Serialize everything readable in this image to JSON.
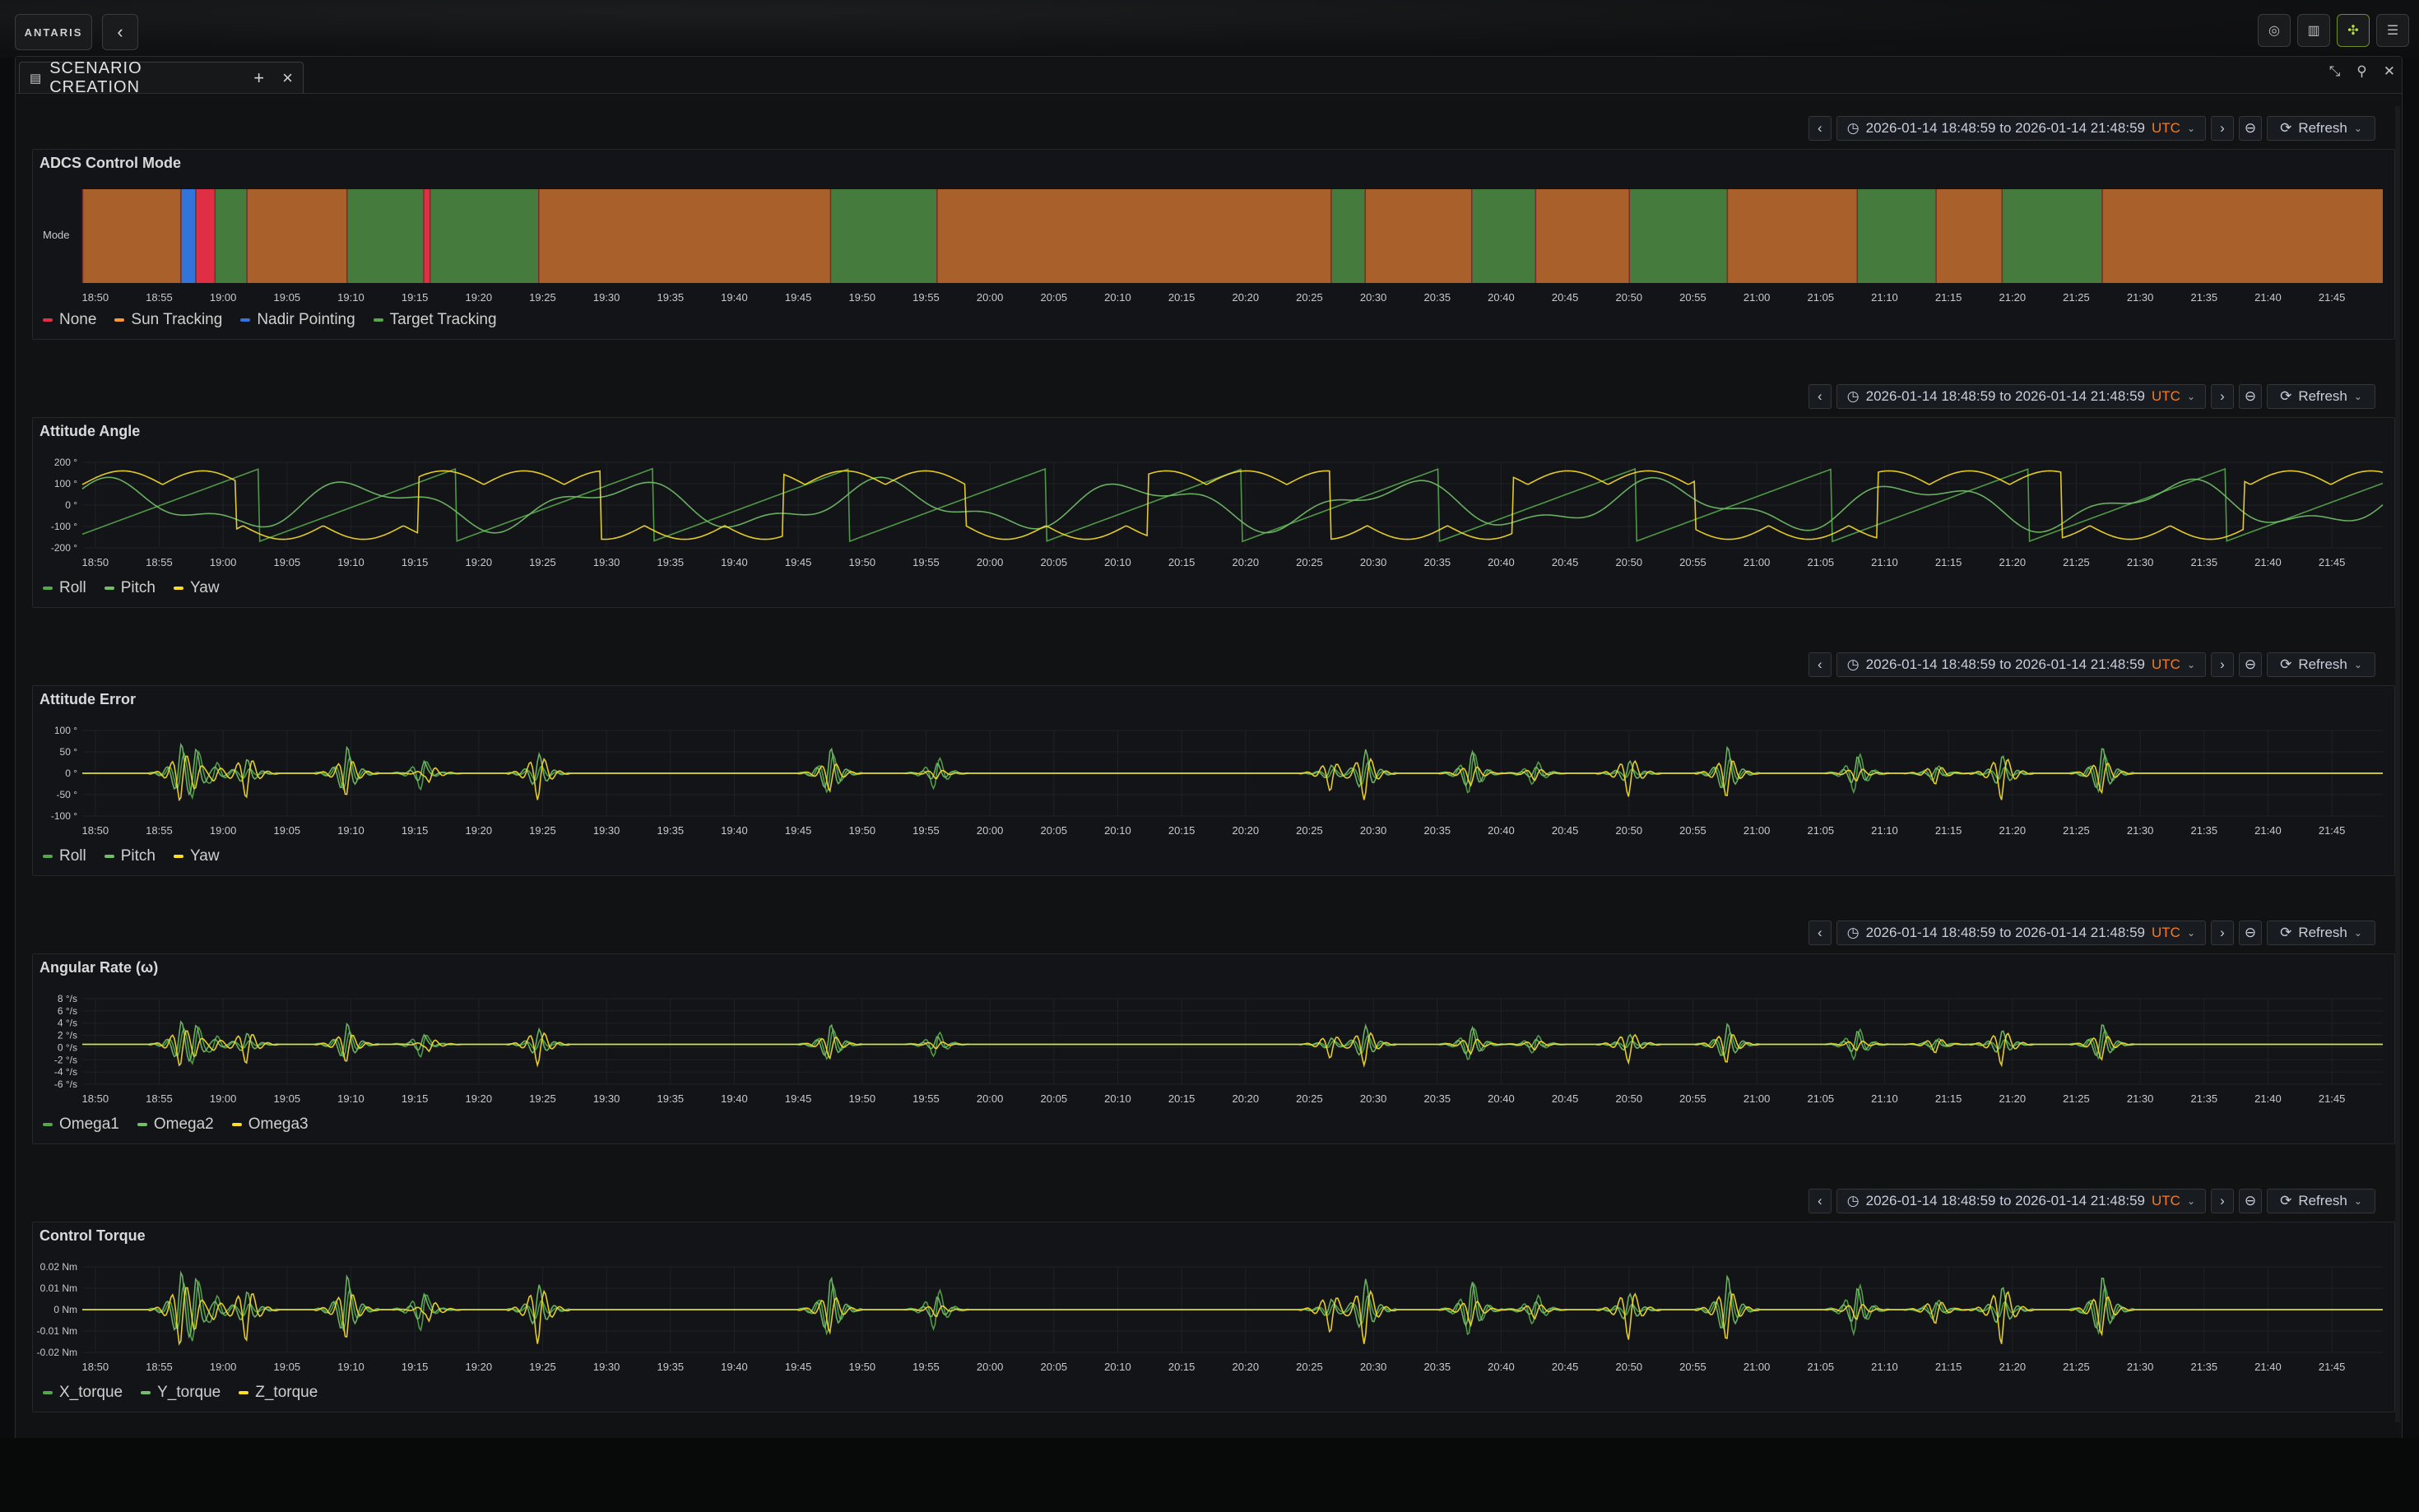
{
  "app": {
    "logo_text": "ANTARIS",
    "back_icon": "chevron-left-icon",
    "top_icons": [
      "satellite-orbit-icon",
      "chart-icon",
      "spacecraft-icon",
      "database-icon"
    ],
    "tab": {
      "title": "SCENARIO CREATION",
      "doc_icon": "document-icon",
      "add_icon": "plus-icon",
      "close_icon": "close-icon"
    },
    "window_controls": [
      "collapse-icon",
      "pin-icon",
      "close-icon"
    ]
  },
  "time_range": {
    "text": "2026-01-14 18:48:59 to 2026-01-14 21:48:59",
    "tz": "UTC",
    "refresh_label": "Refresh",
    "accent": "#f77c1e"
  },
  "colors": {
    "none": "#e02f44",
    "sun_tracking": "#ff9830",
    "nadir_pointing": "#3274d9",
    "target_tracking": "#56a64b",
    "series_a": "#56a64b",
    "series_b": "#73bf69",
    "series_c": "#fade2a"
  },
  "time_axis": [
    "18:50",
    "18:55",
    "19:00",
    "19:05",
    "19:10",
    "19:15",
    "19:20",
    "19:25",
    "19:30",
    "19:35",
    "19:40",
    "19:45",
    "19:50",
    "19:55",
    "20:00",
    "20:05",
    "20:10",
    "20:15",
    "20:20",
    "20:25",
    "20:30",
    "20:35",
    "20:40",
    "20:45",
    "20:50",
    "20:55",
    "21:00",
    "21:05",
    "21:10",
    "21:15",
    "21:20",
    "21:25",
    "21:30",
    "21:35",
    "21:40",
    "21:45"
  ],
  "chart_data": [
    {
      "type": "state-timeline",
      "title": "ADCS Control Mode",
      "row_label": "Mode",
      "legend": [
        "None",
        "Sun Tracking",
        "Nadir Pointing",
        "Target Tracking"
      ],
      "x_range": [
        "18:48:59",
        "21:48:59"
      ],
      "segments": [
        {
          "start": "18:48:59",
          "end": "18:56:40",
          "state": "Sun Tracking"
        },
        {
          "start": "18:56:40",
          "end": "18:57:50",
          "state": "Nadir Pointing"
        },
        {
          "start": "18:57:50",
          "end": "18:59:20",
          "state": "None"
        },
        {
          "start": "18:59:20",
          "end": "19:01:50",
          "state": "Target Tracking"
        },
        {
          "start": "19:01:50",
          "end": "19:09:40",
          "state": "Sun Tracking"
        },
        {
          "start": "19:09:40",
          "end": "19:15:40",
          "state": "Target Tracking"
        },
        {
          "start": "19:15:40",
          "end": "19:16:10",
          "state": "None"
        },
        {
          "start": "19:16:10",
          "end": "19:24:40",
          "state": "Target Tracking"
        },
        {
          "start": "19:24:40",
          "end": "19:47:30",
          "state": "Sun Tracking"
        },
        {
          "start": "19:47:30",
          "end": "19:55:50",
          "state": "Target Tracking"
        },
        {
          "start": "19:55:50",
          "end": "20:26:40",
          "state": "Sun Tracking"
        },
        {
          "start": "20:26:40",
          "end": "20:29:20",
          "state": "Target Tracking"
        },
        {
          "start": "20:29:20",
          "end": "20:37:40",
          "state": "Sun Tracking"
        },
        {
          "start": "20:37:40",
          "end": "20:42:40",
          "state": "Target Tracking"
        },
        {
          "start": "20:42:40",
          "end": "20:50:00",
          "state": "Sun Tracking"
        },
        {
          "start": "20:50:00",
          "end": "20:57:40",
          "state": "Target Tracking"
        },
        {
          "start": "20:57:40",
          "end": "21:07:50",
          "state": "Sun Tracking"
        },
        {
          "start": "21:07:50",
          "end": "21:14:00",
          "state": "Target Tracking"
        },
        {
          "start": "21:14:00",
          "end": "21:19:10",
          "state": "Sun Tracking"
        },
        {
          "start": "21:19:10",
          "end": "21:27:00",
          "state": "Target Tracking"
        },
        {
          "start": "21:27:00",
          "end": "21:48:59",
          "state": "Sun Tracking"
        }
      ]
    },
    {
      "type": "line",
      "title": "Attitude Angle",
      "y_ticks": [
        "200 °",
        "100 °",
        "0 °",
        "-100 °",
        "-200 °"
      ],
      "ylim": [
        -200,
        200
      ],
      "series": [
        {
          "name": "Roll",
          "pattern": "sawtooth"
        },
        {
          "name": "Pitch",
          "pattern": "wave"
        },
        {
          "name": "Yaw",
          "pattern": "square"
        }
      ]
    },
    {
      "type": "line",
      "title": "Attitude Error",
      "y_ticks": [
        "100 °",
        "50 °",
        "0 °",
        "-50 °",
        "-100 °"
      ],
      "ylim": [
        -100,
        100
      ],
      "series": [
        {
          "name": "Roll"
        },
        {
          "name": "Pitch"
        },
        {
          "name": "Yaw"
        }
      ],
      "spike_times": [
        "18:56:00",
        "18:58:00",
        "19:02:30",
        "19:09:40",
        "19:11:00",
        "19:16:10",
        "19:24:40",
        "19:47:30",
        "19:55:50",
        "20:26:40",
        "20:29:20",
        "20:33:00",
        "20:37:40",
        "20:42:40",
        "20:50:00",
        "20:57:40",
        "21:07:50",
        "21:14:00",
        "21:19:10",
        "21:27:00"
      ]
    },
    {
      "type": "line",
      "title": "Angular Rate (ω)",
      "y_ticks": [
        "8 °/s",
        "6 °/s",
        "4 °/s",
        "2 °/s",
        "0 °/s",
        "-2 °/s",
        "-4 °/s",
        "-6 °/s"
      ],
      "ylim": [
        -7,
        8
      ],
      "series": [
        {
          "name": "Omega1"
        },
        {
          "name": "Omega2"
        },
        {
          "name": "Omega3"
        }
      ]
    },
    {
      "type": "line",
      "title": "Control Torque",
      "y_ticks": [
        "0.02 Nm",
        "0.01 Nm",
        "0 Nm",
        "-0.01 Nm",
        "-0.02 Nm"
      ],
      "ylim": [
        -0.02,
        0.02
      ],
      "series": [
        {
          "name": "X_torque"
        },
        {
          "name": "Y_torque"
        },
        {
          "name": "Z_torque"
        }
      ]
    }
  ]
}
